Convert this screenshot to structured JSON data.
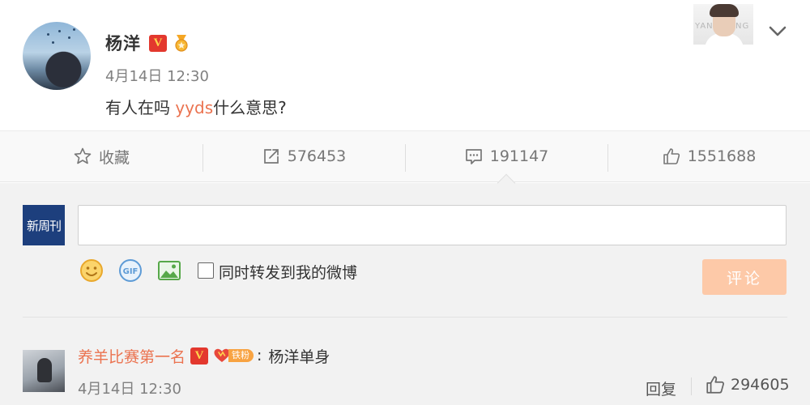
{
  "post": {
    "author": "杨洋",
    "verified_badge": "V",
    "time": "4月14日 12:30",
    "text_before": "有人在吗 ",
    "text_keyword": "yyds",
    "text_after": "什么意思?",
    "corner_thumb_text_left": "YAN",
    "corner_thumb_text_right": "NG",
    "icons": {
      "medal": "medal-icon",
      "expand": "chevron-down-icon"
    }
  },
  "actions": {
    "favorite_label": "收藏",
    "repost_count": "576453",
    "comment_count": "191147",
    "like_count": "1551688",
    "icons": [
      "star-icon",
      "share-icon",
      "comment-icon",
      "thumbs-up-icon"
    ]
  },
  "composer": {
    "brand_logo_text": "新周刊",
    "input_value": "",
    "repost_checkbox_label": "同时转发到我的微博",
    "repost_checked": false,
    "submit_label": "评论",
    "icons": [
      "emoji-icon",
      "gif-icon",
      "image-icon"
    ]
  },
  "comments": [
    {
      "user": "养羊比赛第一名",
      "verified_badge": "V",
      "fan_badge": "铁粉",
      "colon": ":",
      "text": "杨洋单身",
      "time": "4月14日 12:30",
      "reply_label": "回复",
      "likes": "294605"
    }
  ],
  "colors": {
    "accent_orange": "#eb7350",
    "verified_red": "#e3382e",
    "submit_disabled": "#fdc9a8",
    "panel_bg": "#f2f2f2"
  }
}
